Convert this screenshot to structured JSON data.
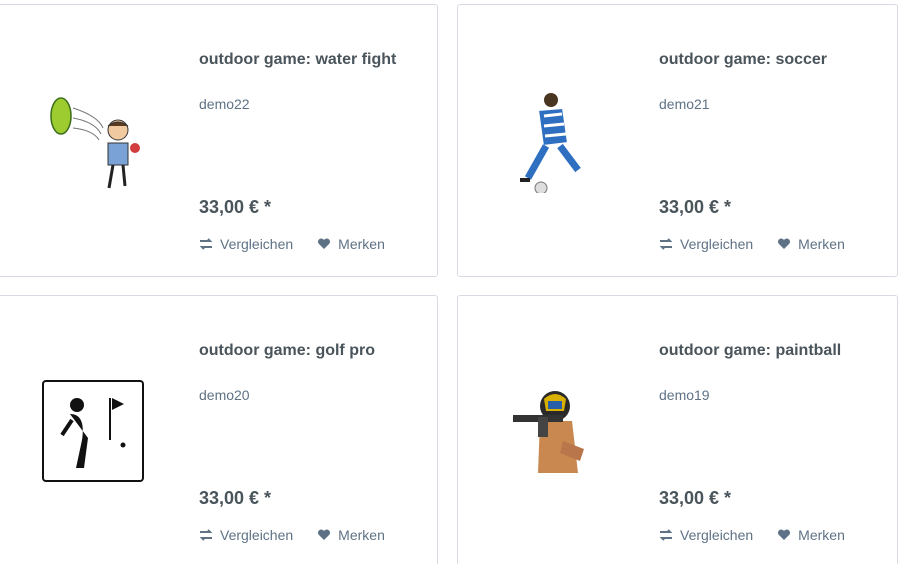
{
  "products": [
    {
      "title": "outdoor game: water fight",
      "desc": "demo22",
      "price": "33,00 € *",
      "compare": "Vergleichen",
      "remember": "Merken",
      "image_icon": "water-fight-icon"
    },
    {
      "title": "outdoor game: soccer",
      "desc": "demo21",
      "price": "33,00 € *",
      "compare": "Vergleichen",
      "remember": "Merken",
      "image_icon": "soccer-player-icon"
    },
    {
      "title": "outdoor game: golf pro",
      "desc": "demo20",
      "price": "33,00 € *",
      "compare": "Vergleichen",
      "remember": "Merken",
      "image_icon": "golf-pro-icon"
    },
    {
      "title": "outdoor game: paintball",
      "desc": "demo19",
      "price": "33,00 € *",
      "compare": "Vergleichen",
      "remember": "Merken",
      "image_icon": "paintball-icon"
    }
  ],
  "colors": {
    "title": "#4a545b",
    "text": "#5f7285",
    "border": "#dadae5"
  }
}
